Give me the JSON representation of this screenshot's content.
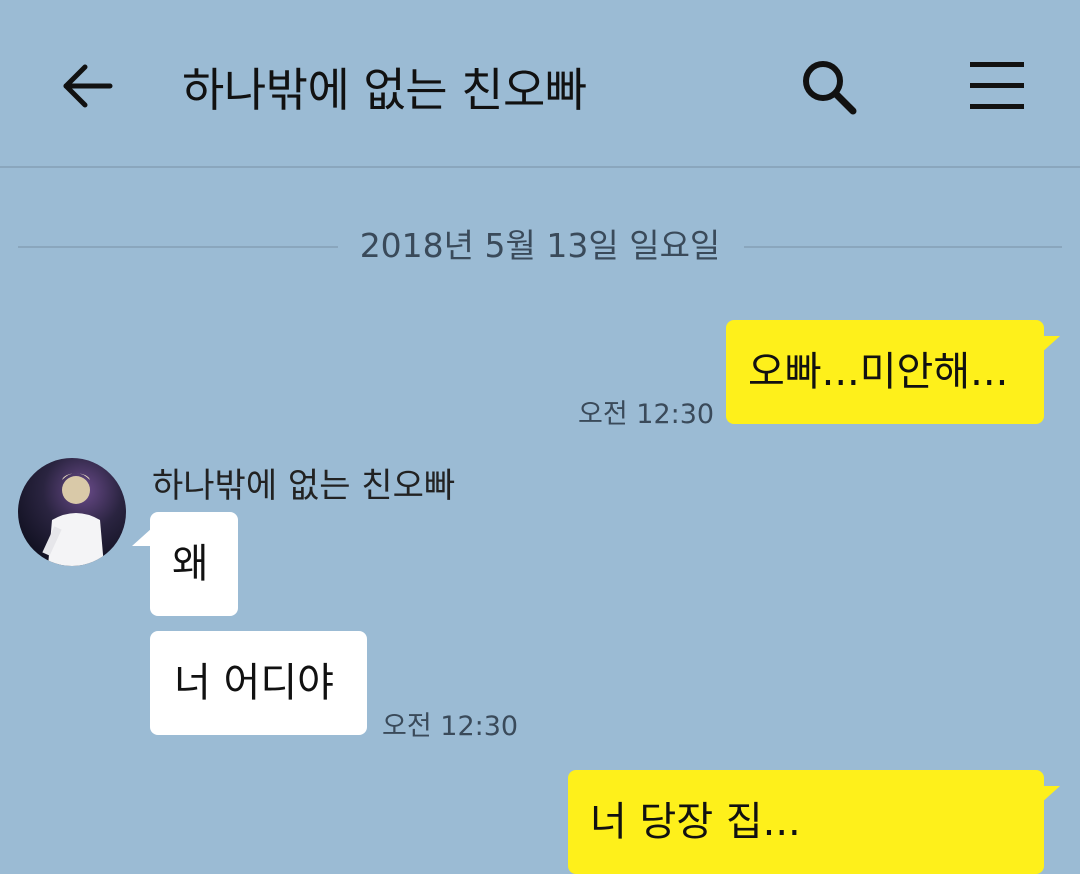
{
  "header": {
    "title": "하나밖에 없는 친오빠",
    "back_icon": "arrow-left-icon",
    "search_icon": "search-icon",
    "menu_icon": "hamburger-menu-icon"
  },
  "date_separator": "2018년 5월 13일 일요일",
  "messages": {
    "m1": {
      "text": "오빠...미안해...",
      "time": "오전 12:30"
    },
    "sender_name": "하나밖에 없는 친오빠",
    "m2": {
      "text": "왜"
    },
    "m3": {
      "text": "너 어디야",
      "time": "오전 12:30"
    },
    "m4": {
      "text": "너 당장 집..."
    }
  },
  "colors": {
    "background": "#9bbbd4",
    "my_bubble": "#fef01b",
    "other_bubble": "#ffffff"
  }
}
